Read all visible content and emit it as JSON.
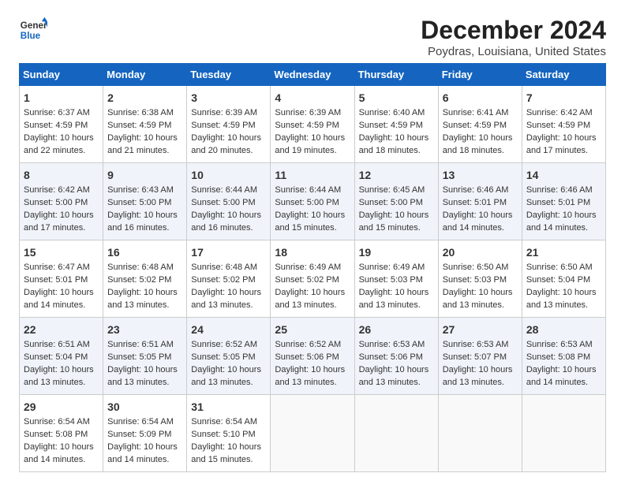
{
  "logo": {
    "line1": "General",
    "line2": "Blue"
  },
  "title": "December 2024",
  "subtitle": "Poydras, Louisiana, United States",
  "headers": [
    "Sunday",
    "Monday",
    "Tuesday",
    "Wednesday",
    "Thursday",
    "Friday",
    "Saturday"
  ],
  "weeks": [
    [
      {
        "day": "1",
        "lines": [
          "Sunrise: 6:37 AM",
          "Sunset: 4:59 PM",
          "Daylight: 10 hours",
          "and 22 minutes."
        ]
      },
      {
        "day": "2",
        "lines": [
          "Sunrise: 6:38 AM",
          "Sunset: 4:59 PM",
          "Daylight: 10 hours",
          "and 21 minutes."
        ]
      },
      {
        "day": "3",
        "lines": [
          "Sunrise: 6:39 AM",
          "Sunset: 4:59 PM",
          "Daylight: 10 hours",
          "and 20 minutes."
        ]
      },
      {
        "day": "4",
        "lines": [
          "Sunrise: 6:39 AM",
          "Sunset: 4:59 PM",
          "Daylight: 10 hours",
          "and 19 minutes."
        ]
      },
      {
        "day": "5",
        "lines": [
          "Sunrise: 6:40 AM",
          "Sunset: 4:59 PM",
          "Daylight: 10 hours",
          "and 18 minutes."
        ]
      },
      {
        "day": "6",
        "lines": [
          "Sunrise: 6:41 AM",
          "Sunset: 4:59 PM",
          "Daylight: 10 hours",
          "and 18 minutes."
        ]
      },
      {
        "day": "7",
        "lines": [
          "Sunrise: 6:42 AM",
          "Sunset: 4:59 PM",
          "Daylight: 10 hours",
          "and 17 minutes."
        ]
      }
    ],
    [
      {
        "day": "8",
        "lines": [
          "Sunrise: 6:42 AM",
          "Sunset: 5:00 PM",
          "Daylight: 10 hours",
          "and 17 minutes."
        ]
      },
      {
        "day": "9",
        "lines": [
          "Sunrise: 6:43 AM",
          "Sunset: 5:00 PM",
          "Daylight: 10 hours",
          "and 16 minutes."
        ]
      },
      {
        "day": "10",
        "lines": [
          "Sunrise: 6:44 AM",
          "Sunset: 5:00 PM",
          "Daylight: 10 hours",
          "and 16 minutes."
        ]
      },
      {
        "day": "11",
        "lines": [
          "Sunrise: 6:44 AM",
          "Sunset: 5:00 PM",
          "Daylight: 10 hours",
          "and 15 minutes."
        ]
      },
      {
        "day": "12",
        "lines": [
          "Sunrise: 6:45 AM",
          "Sunset: 5:00 PM",
          "Daylight: 10 hours",
          "and 15 minutes."
        ]
      },
      {
        "day": "13",
        "lines": [
          "Sunrise: 6:46 AM",
          "Sunset: 5:01 PM",
          "Daylight: 10 hours",
          "and 14 minutes."
        ]
      },
      {
        "day": "14",
        "lines": [
          "Sunrise: 6:46 AM",
          "Sunset: 5:01 PM",
          "Daylight: 10 hours",
          "and 14 minutes."
        ]
      }
    ],
    [
      {
        "day": "15",
        "lines": [
          "Sunrise: 6:47 AM",
          "Sunset: 5:01 PM",
          "Daylight: 10 hours",
          "and 14 minutes."
        ]
      },
      {
        "day": "16",
        "lines": [
          "Sunrise: 6:48 AM",
          "Sunset: 5:02 PM",
          "Daylight: 10 hours",
          "and 13 minutes."
        ]
      },
      {
        "day": "17",
        "lines": [
          "Sunrise: 6:48 AM",
          "Sunset: 5:02 PM",
          "Daylight: 10 hours",
          "and 13 minutes."
        ]
      },
      {
        "day": "18",
        "lines": [
          "Sunrise: 6:49 AM",
          "Sunset: 5:02 PM",
          "Daylight: 10 hours",
          "and 13 minutes."
        ]
      },
      {
        "day": "19",
        "lines": [
          "Sunrise: 6:49 AM",
          "Sunset: 5:03 PM",
          "Daylight: 10 hours",
          "and 13 minutes."
        ]
      },
      {
        "day": "20",
        "lines": [
          "Sunrise: 6:50 AM",
          "Sunset: 5:03 PM",
          "Daylight: 10 hours",
          "and 13 minutes."
        ]
      },
      {
        "day": "21",
        "lines": [
          "Sunrise: 6:50 AM",
          "Sunset: 5:04 PM",
          "Daylight: 10 hours",
          "and 13 minutes."
        ]
      }
    ],
    [
      {
        "day": "22",
        "lines": [
          "Sunrise: 6:51 AM",
          "Sunset: 5:04 PM",
          "Daylight: 10 hours",
          "and 13 minutes."
        ]
      },
      {
        "day": "23",
        "lines": [
          "Sunrise: 6:51 AM",
          "Sunset: 5:05 PM",
          "Daylight: 10 hours",
          "and 13 minutes."
        ]
      },
      {
        "day": "24",
        "lines": [
          "Sunrise: 6:52 AM",
          "Sunset: 5:05 PM",
          "Daylight: 10 hours",
          "and 13 minutes."
        ]
      },
      {
        "day": "25",
        "lines": [
          "Sunrise: 6:52 AM",
          "Sunset: 5:06 PM",
          "Daylight: 10 hours",
          "and 13 minutes."
        ]
      },
      {
        "day": "26",
        "lines": [
          "Sunrise: 6:53 AM",
          "Sunset: 5:06 PM",
          "Daylight: 10 hours",
          "and 13 minutes."
        ]
      },
      {
        "day": "27",
        "lines": [
          "Sunrise: 6:53 AM",
          "Sunset: 5:07 PM",
          "Daylight: 10 hours",
          "and 13 minutes."
        ]
      },
      {
        "day": "28",
        "lines": [
          "Sunrise: 6:53 AM",
          "Sunset: 5:08 PM",
          "Daylight: 10 hours",
          "and 14 minutes."
        ]
      }
    ],
    [
      {
        "day": "29",
        "lines": [
          "Sunrise: 6:54 AM",
          "Sunset: 5:08 PM",
          "Daylight: 10 hours",
          "and 14 minutes."
        ]
      },
      {
        "day": "30",
        "lines": [
          "Sunrise: 6:54 AM",
          "Sunset: 5:09 PM",
          "Daylight: 10 hours",
          "and 14 minutes."
        ]
      },
      {
        "day": "31",
        "lines": [
          "Sunrise: 6:54 AM",
          "Sunset: 5:10 PM",
          "Daylight: 10 hours",
          "and 15 minutes."
        ]
      },
      {
        "day": "",
        "lines": []
      },
      {
        "day": "",
        "lines": []
      },
      {
        "day": "",
        "lines": []
      },
      {
        "day": "",
        "lines": []
      }
    ]
  ]
}
